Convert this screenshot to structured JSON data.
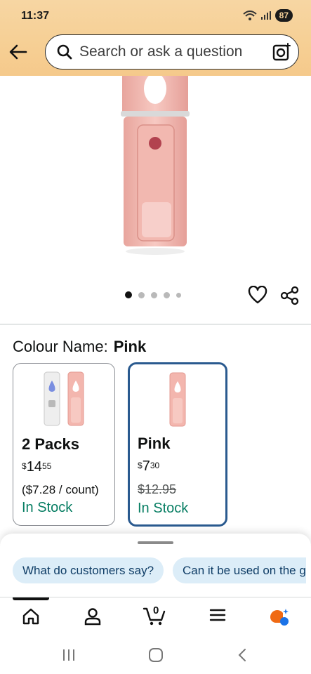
{
  "status_bar": {
    "time": "11:37",
    "battery": "87"
  },
  "search": {
    "placeholder": "Search or ask a question"
  },
  "product": {
    "image_count": 5,
    "active_image": 1
  },
  "variation": {
    "label": "Colour Name:",
    "selected_value": "Pink"
  },
  "options": [
    {
      "title": "2 Packs",
      "price_currency": "$",
      "price_whole": "14",
      "price_fraction": "55",
      "per_unit": "($7.28 / count)",
      "availability": "In Stock",
      "selected": false
    },
    {
      "title": "Pink",
      "price_currency": "$",
      "price_whole": "7",
      "price_fraction": "30",
      "list_price": "$12.95",
      "availability": "In Stock",
      "selected": true
    }
  ],
  "questions": [
    {
      "label": "What do customers say?"
    },
    {
      "label": "Can it be used on the g"
    }
  ],
  "cart": {
    "count": "0"
  },
  "colors": {
    "header": "#f6cf94",
    "selected_border": "#2a5a8f",
    "in_stock": "#067d62",
    "chip_bg": "#dcedf8"
  }
}
